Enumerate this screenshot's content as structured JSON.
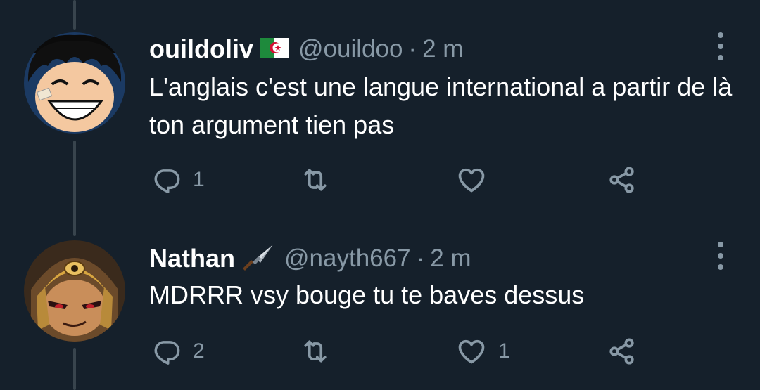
{
  "tweets": [
    {
      "display_name": "ouildoliv",
      "name_emoji": "algeria-flag",
      "handle": "@ouildoo",
      "separator": "·",
      "time": "2 m",
      "text": "L'anglais c'est une langue international a partir de là ton argument tien pas",
      "reply_count": "1",
      "retweet_count": "",
      "like_count": ""
    },
    {
      "display_name": "Nathan",
      "name_emoji": "dagger",
      "handle": "@nayth667",
      "separator": "·",
      "time": "2 m",
      "text": "MDRRR vsy bouge tu te baves dessus",
      "reply_count": "2",
      "retweet_count": "",
      "like_count": "1"
    }
  ],
  "colors": {
    "background": "#15202b",
    "secondary_text": "#8899a6",
    "thread_line": "#38444d"
  },
  "icons": [
    "reply-icon",
    "retweet-icon",
    "like-icon",
    "share-icon",
    "more-icon"
  ]
}
